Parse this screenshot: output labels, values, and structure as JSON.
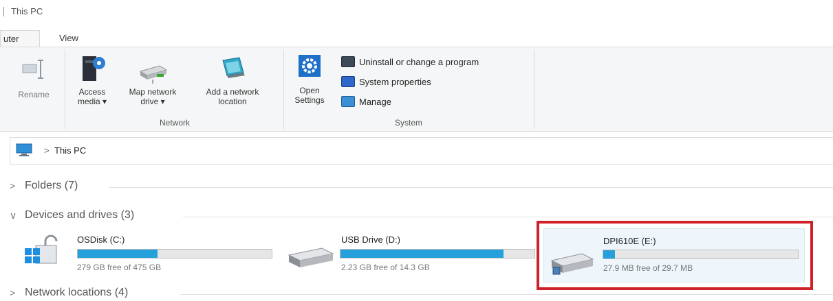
{
  "window": {
    "title": "This PC"
  },
  "tabs": [
    {
      "label": "uter"
    },
    {
      "label": "View"
    }
  ],
  "ribbon": {
    "rename": {
      "label": "Rename"
    },
    "network": {
      "group_label": "Network",
      "buttons": [
        {
          "line1": "Access",
          "line2": "media ▾"
        },
        {
          "line1": "Map network",
          "line2": "drive ▾"
        },
        {
          "line1": "Add a network",
          "line2": "location"
        }
      ]
    },
    "system": {
      "group_label": "System",
      "open_settings": {
        "line1": "Open",
        "line2": "Settings"
      },
      "items": [
        {
          "label": "Uninstall or change a program",
          "icon": "uninstall-icon"
        },
        {
          "label": "System properties",
          "icon": "properties-icon"
        },
        {
          "label": "Manage",
          "icon": "manage-icon"
        }
      ]
    }
  },
  "address": {
    "chevron": ">",
    "path": "This PC"
  },
  "sections": {
    "folders": {
      "chevron": ">",
      "label": "Folders (7)"
    },
    "devices": {
      "chevron": "∨",
      "label": "Devices and drives (3)"
    },
    "network": {
      "chevron": ">",
      "label": "Network locations (4)"
    }
  },
  "drives": [
    {
      "name": "OSDisk (C:)",
      "free": "279 GB free of 475 GB",
      "used_fraction": 0.41,
      "icon": "windows-drive-icon"
    },
    {
      "name": "USB Drive (D:)",
      "free": "2.23 GB free of 14.3 GB",
      "used_fraction": 0.84,
      "icon": "usb-drive-icon"
    },
    {
      "name": "DPI610E (E:)",
      "free": "27.9 MB free of 29.7 MB",
      "used_fraction": 0.06,
      "icon": "removable-drive-icon"
    }
  ],
  "colors": {
    "accent": "#26a0da",
    "highlight": "#d0202a"
  }
}
